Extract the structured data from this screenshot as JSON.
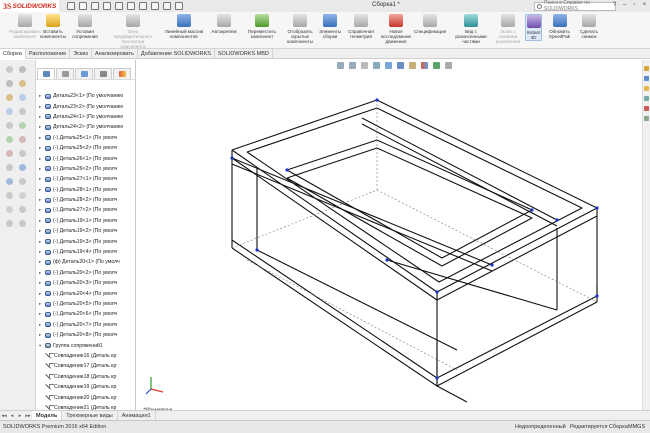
{
  "app": {
    "logo_ds": "3S",
    "logo_name": "SOLIDWORKS",
    "document_title": "Сборка1 *",
    "help_search_placeholder": "Поиск в Справке по SOLIDWORKS"
  },
  "commands": [
    {
      "label": "Редактировать компонент",
      "icon": "edit-component-icon",
      "color": "gray",
      "dim": true
    },
    {
      "label": "Вставить компоненты",
      "icon": "insert-components-icon",
      "color": "yellow",
      "dim": false
    },
    {
      "label": "Условия сопряжения",
      "icon": "mate-icon",
      "color": "gray",
      "dim": false
    },
    {
      "label": "Окно предварительного просмотра компонента",
      "icon": "preview-window-icon",
      "color": "gray",
      "dim": true
    },
    {
      "label": "Линейный массив компонентов",
      "icon": "linear-pattern-icon",
      "color": "blue",
      "dim": false
    },
    {
      "label": "Автокрепеж",
      "icon": "smart-fasteners-icon",
      "color": "gray",
      "dim": false
    },
    {
      "label": "Переместить компонент",
      "icon": "move-component-icon",
      "color": "green",
      "dim": false
    },
    {
      "label": "Отобразить скрытые компоненты",
      "icon": "show-hidden-icon",
      "color": "gray",
      "dim": false
    },
    {
      "label": "Элементы сборки",
      "icon": "assembly-features-icon",
      "color": "blue",
      "dim": false
    },
    {
      "label": "Справочная геометрия",
      "icon": "reference-geometry-icon",
      "color": "gray",
      "dim": false
    },
    {
      "label": "Новое исследование движения",
      "icon": "motion-study-icon",
      "color": "red",
      "dim": false
    },
    {
      "label": "Спецификация",
      "icon": "bom-icon",
      "color": "gray",
      "dim": false
    },
    {
      "label": "Вид с разнесенными частями",
      "icon": "exploded-view-icon",
      "color": "teal",
      "dim": false
    },
    {
      "label": "Эскиз с линиями разнесения",
      "icon": "explode-line-icon",
      "color": "gray",
      "dim": true
    },
    {
      "label": "Instant 3D",
      "icon": "instant3d-icon",
      "color": "purple",
      "dim": false,
      "active": true
    },
    {
      "label": "Обновить SpeedPak",
      "icon": "speedpak-icon",
      "color": "blue",
      "dim": false
    },
    {
      "label": "Сделать снимок",
      "icon": "snapshot-icon",
      "color": "gray",
      "dim": false
    }
  ],
  "command_tabs": [
    "Сборка",
    "Расположение",
    "Эскиз",
    "Анализировать",
    "Добавление SOLIDWORKS",
    "SOLIDWORKS MBD"
  ],
  "feature_tree": [
    {
      "type": "part",
      "label": "Деталь23<1> (По умолчанию"
    },
    {
      "type": "part",
      "label": "Деталь23<2> (По умолчанию"
    },
    {
      "type": "part",
      "label": "Деталь24<1> (По умолчанию"
    },
    {
      "type": "part",
      "label": "Деталь24<2> (По умолчанию"
    },
    {
      "type": "part",
      "label": "(-) Деталь25<1> (По умолч"
    },
    {
      "type": "part",
      "label": "(-) Деталь25<2> (По умолч"
    },
    {
      "type": "part",
      "label": "(-) Деталь26<1> (По умолч"
    },
    {
      "type": "part",
      "label": "(-) Деталь26<2> (По умолч"
    },
    {
      "type": "part",
      "label": "(-) Деталь27<1> (По умолч"
    },
    {
      "type": "part",
      "label": "(-) Деталь28<1> (По умолч"
    },
    {
      "type": "part",
      "label": "(-) Деталь28<2> (По умолч"
    },
    {
      "type": "part",
      "label": "(-) Деталь27<2> (По умолч"
    },
    {
      "type": "part",
      "label": "(-) Деталь19<1> (По умолч"
    },
    {
      "type": "part",
      "label": "(-) Деталь19<2> (По умолч"
    },
    {
      "type": "part",
      "label": "(-) Деталь19<3> (По умолч"
    },
    {
      "type": "part",
      "label": "(-) Деталь19<4> (По умолч"
    },
    {
      "type": "part",
      "label": "(ф) Деталь20<1> (По умолч"
    },
    {
      "type": "part",
      "label": "(-) Деталь20<2> (По умолч"
    },
    {
      "type": "part",
      "label": "(-) Деталь20<3> (По умолч"
    },
    {
      "type": "part",
      "label": "(-) Деталь20<4> (По умолч"
    },
    {
      "type": "part",
      "label": "(-) Деталь20<5> (По умолч"
    },
    {
      "type": "part",
      "label": "(-) Деталь20<6> (По умолч"
    },
    {
      "type": "part",
      "label": "(-) Деталь20<7> (По умолч"
    },
    {
      "type": "part",
      "label": "(-) Деталь20<8> (По умолч"
    },
    {
      "type": "group",
      "label": "Группа сопряжений1"
    },
    {
      "type": "mate",
      "label": "Совпадение16 (Деталь кр"
    },
    {
      "type": "mate",
      "label": "Совпадение17 (Деталь кр"
    },
    {
      "type": "mate",
      "label": "Совпадение18 (Деталь кр"
    },
    {
      "type": "mate",
      "label": "Совпадение19 (Деталь кр"
    },
    {
      "type": "mate",
      "label": "Совпадение20 (Деталь кр"
    },
    {
      "type": "mate",
      "label": "Совпадение21 (Деталь кр"
    },
    {
      "type": "mate",
      "label": "Совпадение22 (Деталь кр"
    },
    {
      "type": "mate",
      "label": "Совпадение23 (Деталь кр"
    },
    {
      "type": "mate",
      "label": "Совпадение24 (Деталь кр"
    }
  ],
  "viewport": {
    "view_label": "*Изометрия"
  },
  "bottom_tabs": [
    "Модель",
    "Трехмерные виды",
    "Анимация1"
  ],
  "status": {
    "product": "SOLIDWORKS Premium 2016 x64 Edition",
    "state": "Недоопределенный",
    "mode": "Редактируется Сборка",
    "units": "MMGS"
  },
  "colors": {
    "accent": "#3a6fbd",
    "brand": "#d52b1e",
    "model_line": "#111111",
    "handle": "#1a33c8"
  }
}
